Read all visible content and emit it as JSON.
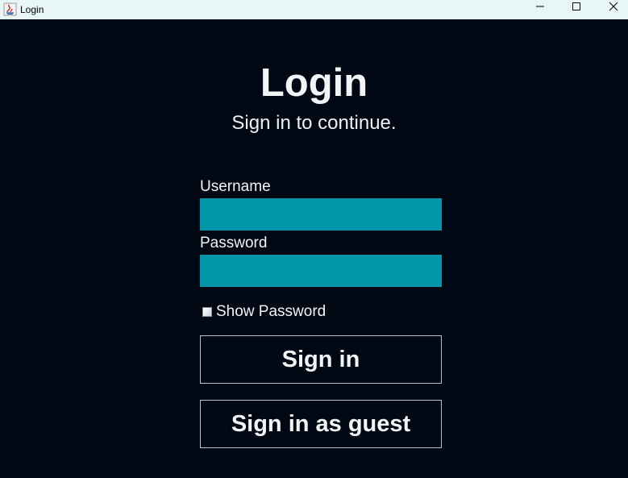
{
  "window": {
    "title": "Login",
    "icon": "java-app-icon",
    "controls": {
      "minimize_icon": "minimize-icon",
      "maximize_icon": "maximize-icon",
      "close_icon": "close-icon"
    }
  },
  "form": {
    "title": "Login",
    "subtitle": "Sign in to continue.",
    "username": {
      "label": "Username",
      "value": ""
    },
    "password": {
      "label": "Password",
      "value": ""
    },
    "show_password": {
      "label": "Show Password",
      "checked": false
    },
    "sign_in_label": "Sign in",
    "guest_label": "Sign in as guest"
  },
  "colors": {
    "background": "#000814",
    "input_fill": "#0097ab",
    "text": "#f2f4f6",
    "button_border": "#b9c1c9",
    "titlebar": "#e8f6f6"
  }
}
